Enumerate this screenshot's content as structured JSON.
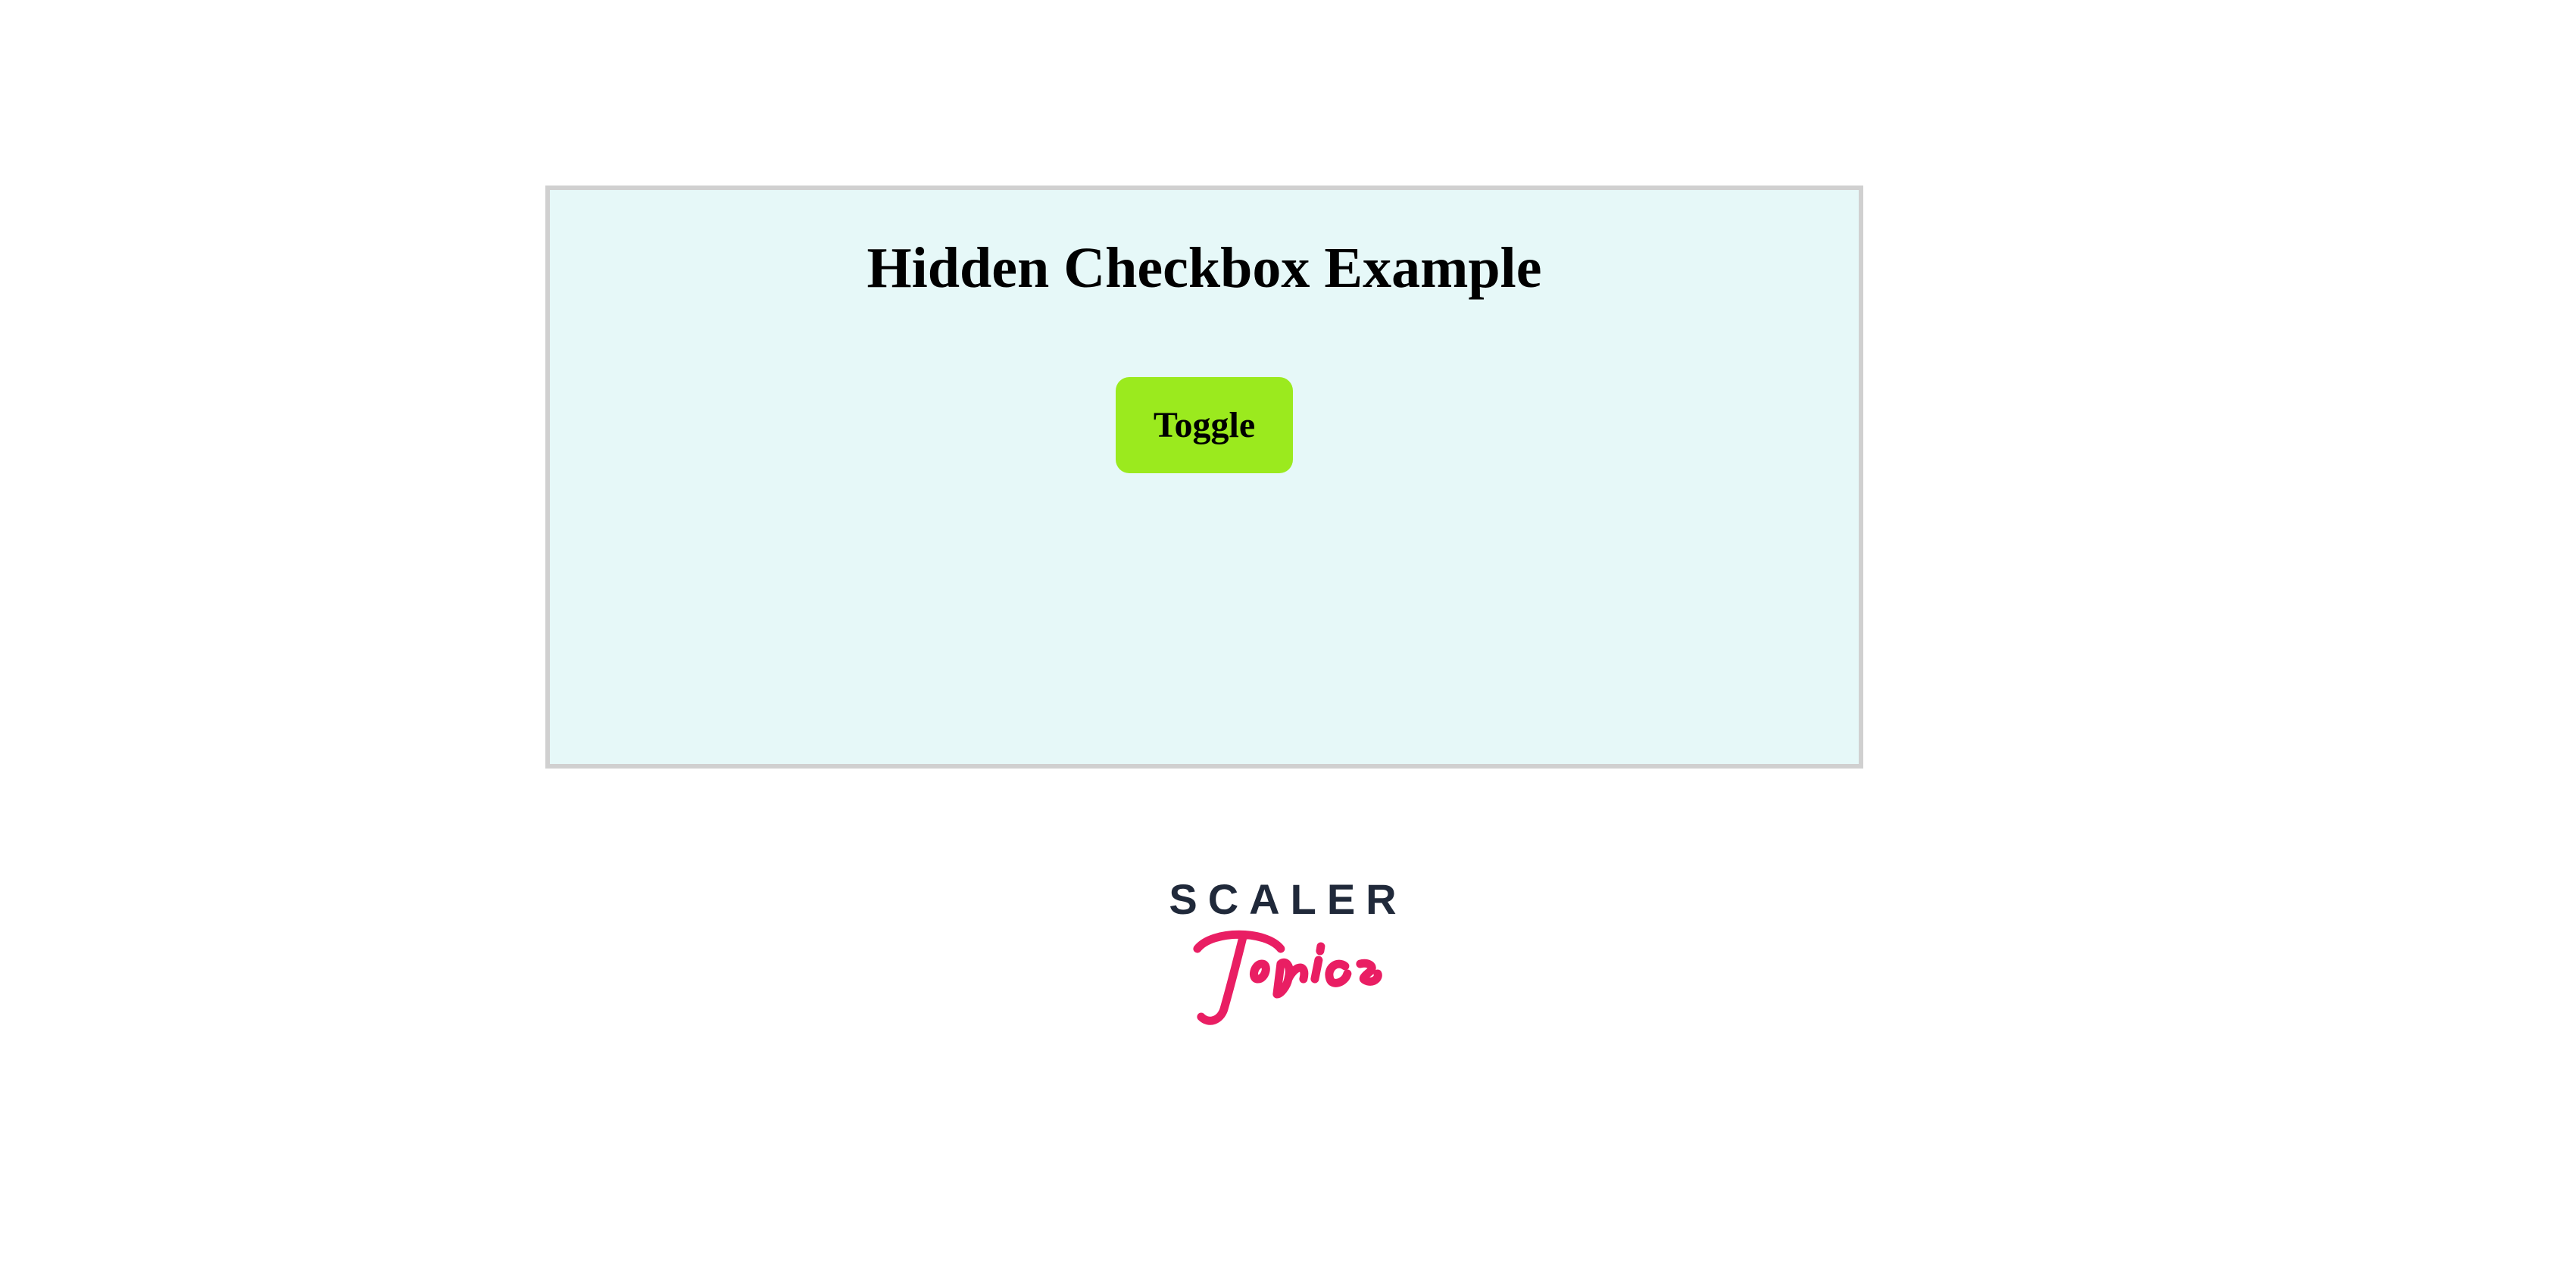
{
  "panel": {
    "heading": "Hidden Checkbox Example",
    "toggle_label": "Toggle"
  },
  "footer": {
    "brand_line1": "SCALER",
    "brand_line2": "Topics"
  }
}
